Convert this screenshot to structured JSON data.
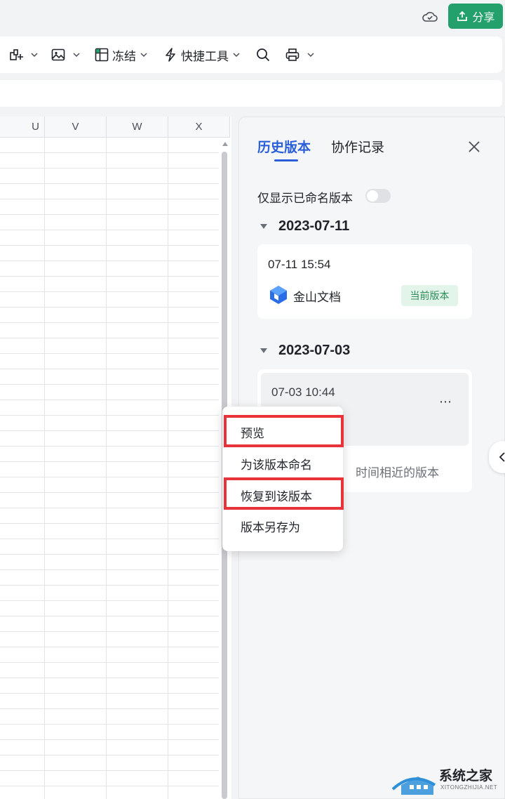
{
  "header": {
    "share_label": "分享"
  },
  "toolbar": {
    "freeze_label": "冻结",
    "quick_tools_label": "快捷工具"
  },
  "sheet": {
    "columns": [
      "U",
      "V",
      "W",
      "X"
    ]
  },
  "history_panel": {
    "tabs": [
      "历史版本",
      "协作记录"
    ],
    "active_tab": "历史版本",
    "named_only_label": "仅显示已命名版本",
    "named_only_enabled": false,
    "groups": [
      {
        "date": "2023-07-11",
        "versions": [
          {
            "time": "07-11 15:54",
            "author": "金山文档",
            "badge": "当前版本"
          }
        ]
      },
      {
        "date": "2023-07-03",
        "versions": [
          {
            "time": "07-03 10:44",
            "more": "⋯"
          }
        ],
        "footer_text": "时间相近的版本"
      }
    ]
  },
  "context_menu": {
    "items": [
      "预览",
      "为该版本命名",
      "恢复到该版本",
      "版本另存为"
    ],
    "highlighted": [
      "预览",
      "恢复到该版本"
    ]
  },
  "watermark": {
    "text": "系统之家",
    "sub": "XITONGZHIJIA.NET"
  },
  "colors": {
    "accent": "#2b5fd9",
    "share_button": "#23a06b",
    "highlight_border": "#e8333a",
    "badge_bg": "#e3f4ea"
  }
}
